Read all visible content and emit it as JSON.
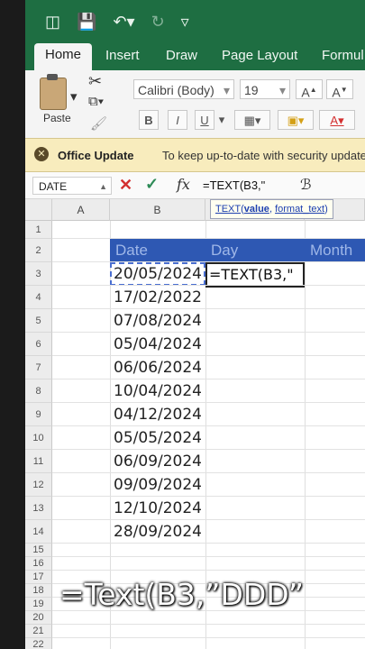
{
  "ribbon_tabs": [
    "Home",
    "Insert",
    "Draw",
    "Page Layout",
    "Formul"
  ],
  "ribbon": {
    "paste_label": "Paste",
    "font_name": "Calibri (Body)",
    "font_size": "19",
    "bold": "B",
    "italic": "I",
    "underline": "U",
    "grow": "A",
    "shrink": "A",
    "font_color": "A"
  },
  "update_bar": {
    "title": "Office Update",
    "message": "To keep up-to-date with security updates, fix"
  },
  "formula_bar": {
    "name_box": "DATE",
    "fx": "fx",
    "formula": "=TEXT(B3,\""
  },
  "tooltip": {
    "fn": "TEXT",
    "arg1": "value",
    "arg2": "format_text"
  },
  "columns": [
    "A",
    "B"
  ],
  "headers": [
    "Date",
    "Day",
    "Month"
  ],
  "dates": [
    "20/05/2024",
    "17/02/2022",
    "07/08/2024",
    "05/04/2024",
    "06/06/2024",
    "10/04/2024",
    "04/12/2024",
    "05/05/2024",
    "06/09/2024",
    "09/09/2024",
    "12/10/2024",
    "28/09/2024"
  ],
  "active_cell_text": "=TEXT(B3,\"",
  "row_numbers": [
    "1",
    "2",
    "3",
    "4",
    "5",
    "6",
    "7",
    "8",
    "9",
    "10",
    "11",
    "12",
    "13",
    "14",
    "15",
    "16",
    "17",
    "18",
    "19",
    "20",
    "21",
    "22"
  ],
  "caption": "=Text(B3,”DDD”",
  "colors": {
    "excel_green": "#1e6e42",
    "header_blue": "#2e58b3",
    "update_yellow": "#f8ecbd"
  }
}
